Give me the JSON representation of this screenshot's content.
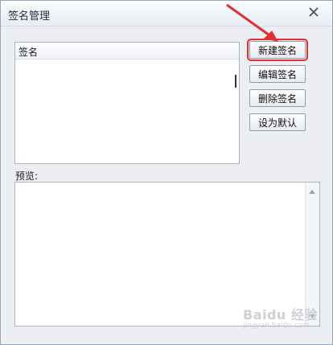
{
  "dialog": {
    "title": "签名管理"
  },
  "signature_list": {
    "column_header": "签名"
  },
  "buttons": {
    "new_signature": "新建签名",
    "edit_signature": "编辑签名",
    "delete_signature": "删除签名",
    "set_default": "设为默认"
  },
  "preview": {
    "label": "预览:"
  },
  "watermark": {
    "text": "Baidu 经验",
    "subtext": "jingyan.baidu.com"
  },
  "colors": {
    "annotation_red": "#e03030",
    "highlight_border": "#e03030"
  }
}
